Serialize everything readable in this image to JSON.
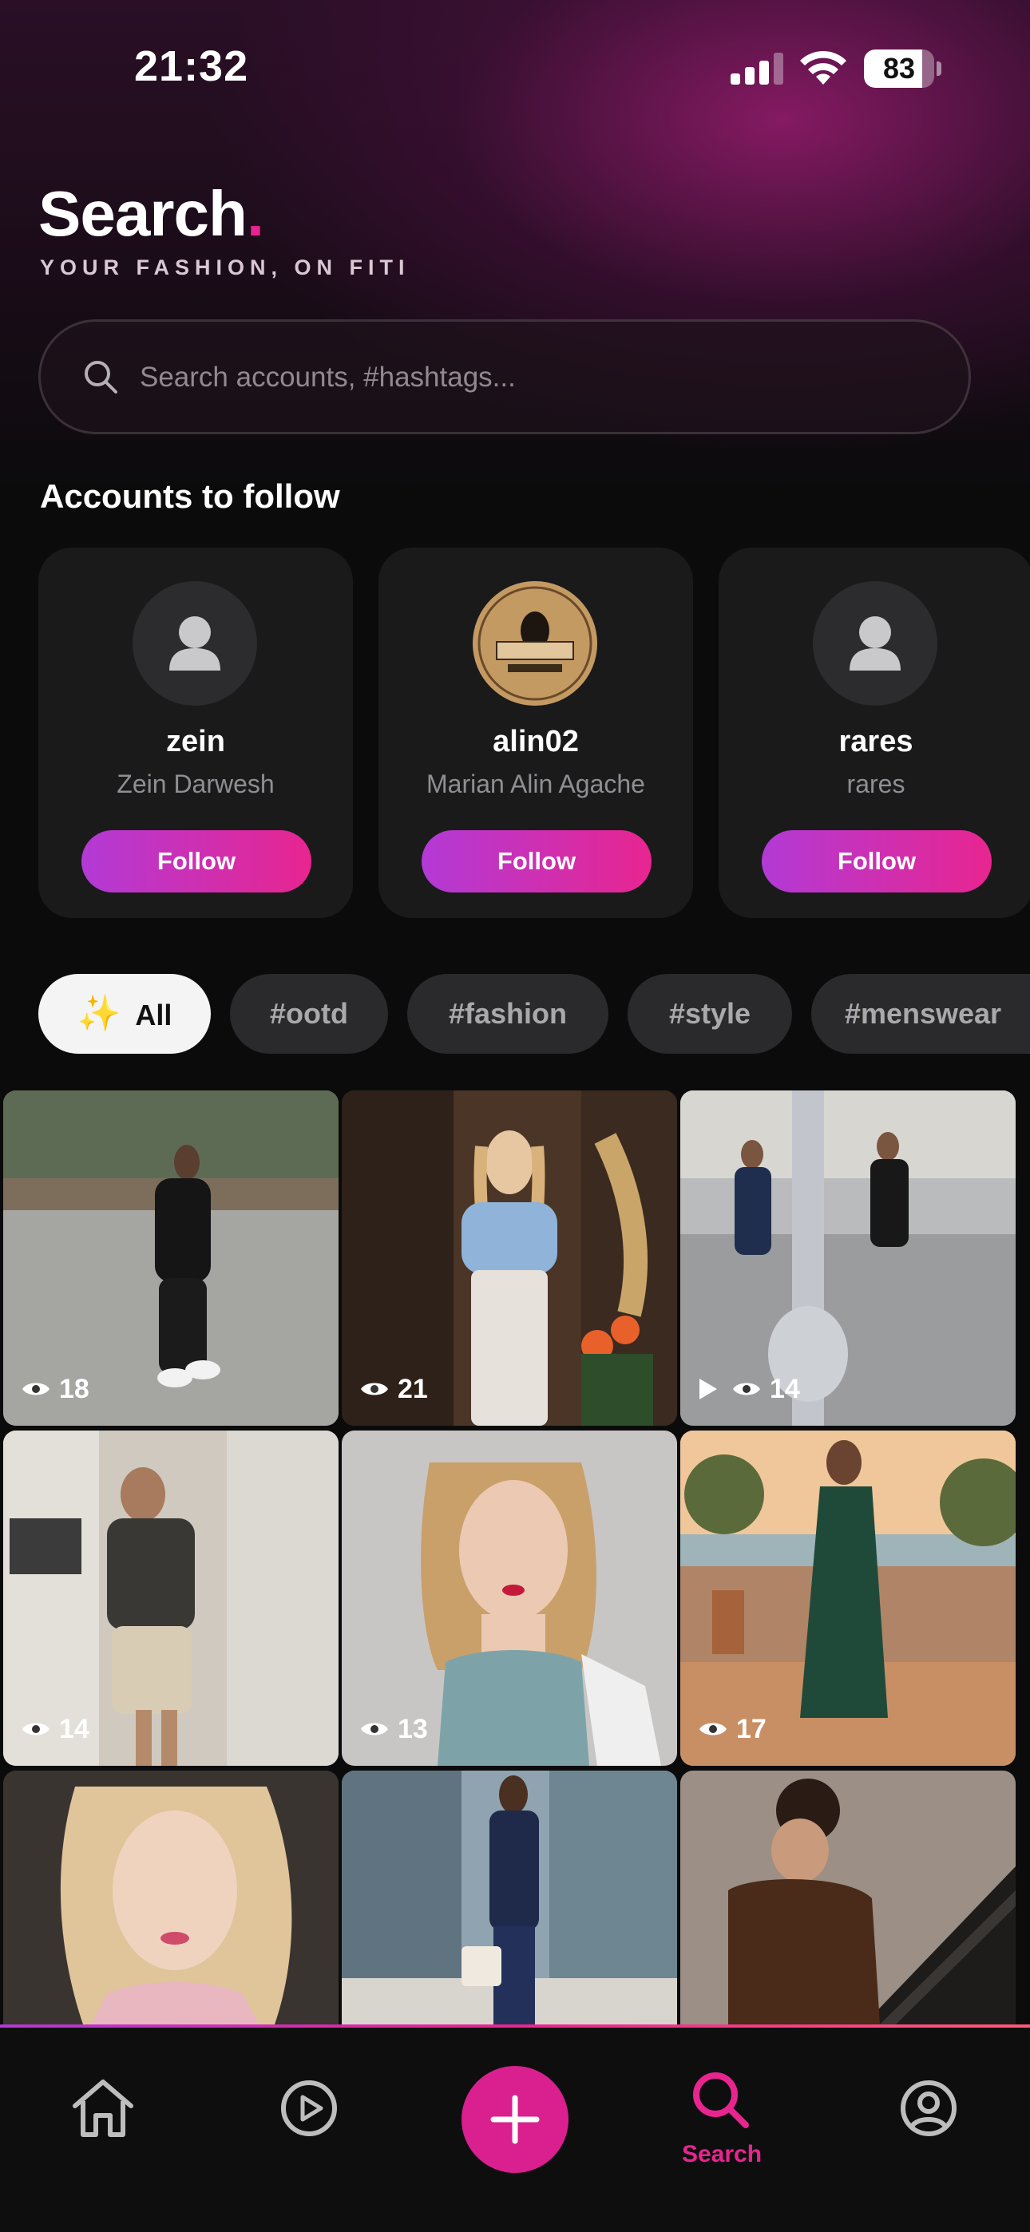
{
  "status_bar": {
    "time": "21:32",
    "battery": "83",
    "battery_level": 0.83
  },
  "header": {
    "title": "Search",
    "title_dot": ".",
    "subtitle": "YOUR FASHION, ON FITI"
  },
  "search": {
    "placeholder": "Search accounts, #hashtags..."
  },
  "accounts_section": {
    "title": "Accounts to follow",
    "accounts": [
      {
        "username": "zein",
        "full_name": "Zein Darwesh",
        "follow_label": "Follow",
        "avatar": "default-avatar-icon"
      },
      {
        "username": "alin02",
        "full_name": "Marian Alin Agache",
        "follow_label": "Follow",
        "avatar": "barber-logo"
      },
      {
        "username": "rares",
        "full_name": "rares",
        "follow_label": "Follow",
        "avatar": "default-avatar-icon"
      }
    ]
  },
  "filters": [
    {
      "label": "All",
      "icon": "sparkles-icon",
      "active": true
    },
    {
      "label": "#ootd",
      "active": false
    },
    {
      "label": "#fashion",
      "active": false
    },
    {
      "label": "#style",
      "active": false
    },
    {
      "label": "#menswear",
      "active": false
    }
  ],
  "posts": [
    {
      "views": "18",
      "video": false
    },
    {
      "views": "21",
      "video": false
    },
    {
      "views": "14",
      "video": true
    },
    {
      "views": "14",
      "video": false
    },
    {
      "views": "13",
      "video": false
    },
    {
      "views": "17",
      "video": false
    },
    {
      "views": "",
      "video": false
    },
    {
      "views": "",
      "video": false
    },
    {
      "views": "",
      "video": false
    }
  ],
  "bottom_nav": {
    "items": [
      "home-icon",
      "play-circle-icon",
      "plus-icon",
      "search-icon",
      "profile-icon"
    ],
    "active_label": "Search"
  },
  "colors": {
    "accent": "#e8258f",
    "accent_purple": "#b23ad6",
    "background": "#0b0b0c",
    "card": "#1a1a1b"
  }
}
